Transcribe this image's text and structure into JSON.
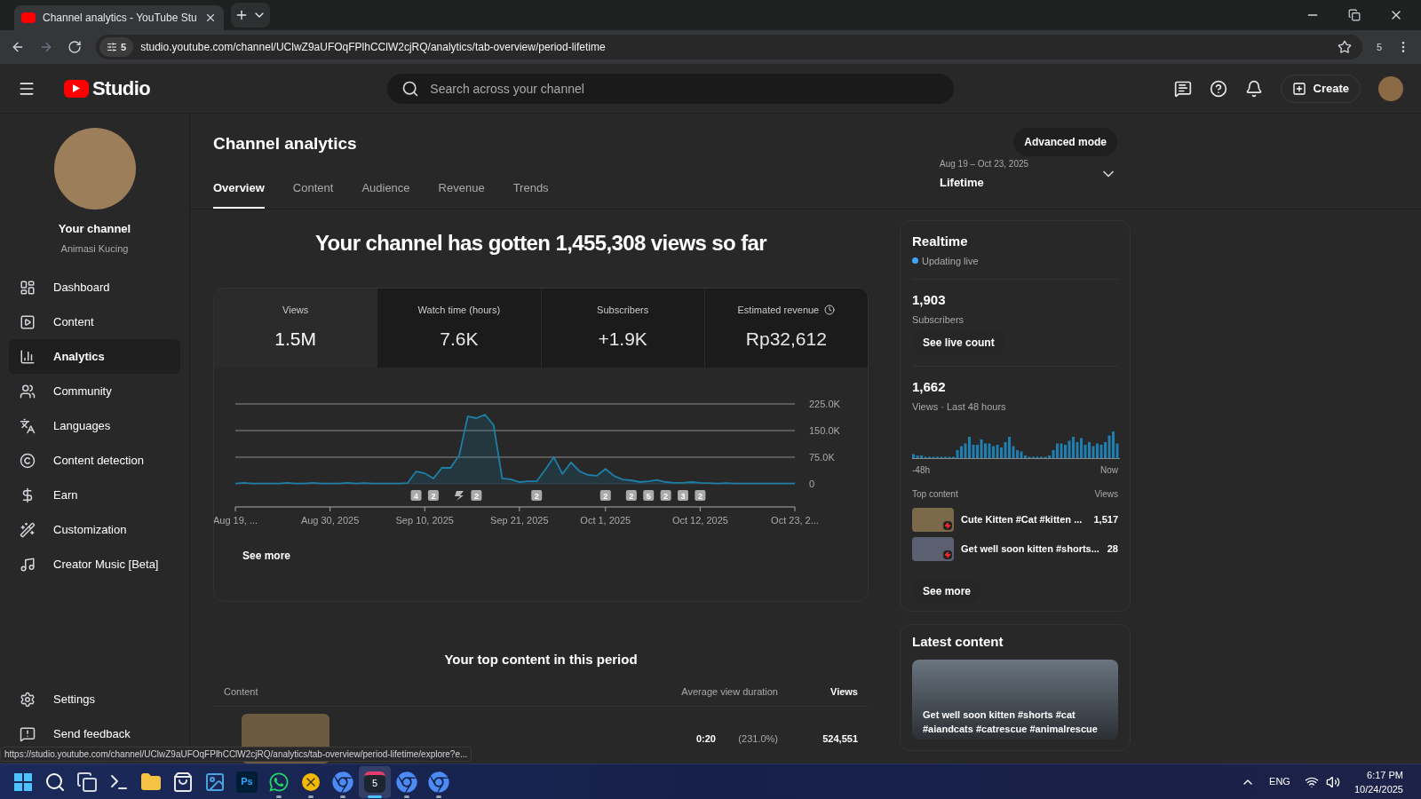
{
  "browser": {
    "tab_title": "Channel analytics - YouTube Stu",
    "url": "studio.youtube.com/channel/UClwZ9aUFOqFPlhCClW2cjRQ/analytics/tab-overview/period-lifetime",
    "site_badge": "5",
    "extensions_count": "5"
  },
  "header": {
    "logo": "Studio",
    "search": {
      "placeholder": "Search across your channel"
    },
    "create": "Create"
  },
  "sidebar": {
    "channel_title": "Your channel",
    "channel_name": "Animasi Kucing",
    "items": [
      {
        "label": "Dashboard",
        "selected": false
      },
      {
        "label": "Content",
        "selected": false
      },
      {
        "label": "Analytics",
        "selected": true
      },
      {
        "label": "Community",
        "selected": false
      },
      {
        "label": "Languages",
        "selected": false
      },
      {
        "label": "Content detection",
        "selected": false
      },
      {
        "label": "Earn",
        "selected": false
      },
      {
        "label": "Customization",
        "selected": false
      },
      {
        "label": "Creator Music [Beta]",
        "selected": false
      }
    ],
    "footer_items": [
      {
        "label": "Settings"
      },
      {
        "label": "Send feedback"
      }
    ]
  },
  "page": {
    "title": "Channel analytics",
    "advanced_mode": "Advanced mode",
    "tabs": [
      {
        "label": "Overview",
        "selected": true
      },
      {
        "label": "Content",
        "selected": false
      },
      {
        "label": "Audience",
        "selected": false
      },
      {
        "label": "Revenue",
        "selected": false
      },
      {
        "label": "Trends",
        "selected": false
      }
    ],
    "date_range": {
      "dates": "Aug 19 – Oct 23, 2025",
      "period": "Lifetime"
    }
  },
  "headline": "Your channel has gotten 1,455,308 views so far",
  "metrics": [
    {
      "label": "Views",
      "value": "1.5M",
      "selected": true
    },
    {
      "label": "Watch time (hours)",
      "value": "7.6K",
      "selected": false
    },
    {
      "label": "Subscribers",
      "value": "+1.9K",
      "selected": false
    },
    {
      "label": "Estimated revenue",
      "value": "Rp32,612",
      "selected": false
    }
  ],
  "chart_data": {
    "type": "area",
    "categories": [
      "Aug 19, ...",
      null,
      null,
      null,
      null,
      null,
      null,
      null,
      null,
      null,
      null,
      "Aug 30, 2025",
      null,
      null,
      null,
      null,
      null,
      null,
      null,
      null,
      null,
      null,
      "Sep 10, 2025",
      null,
      null,
      null,
      null,
      null,
      null,
      null,
      null,
      null,
      null,
      "Sep 21, 2025",
      null,
      null,
      null,
      null,
      null,
      null,
      null,
      null,
      null,
      "Oct 1, 2025",
      null,
      null,
      null,
      null,
      null,
      null,
      null,
      null,
      null,
      null,
      "Oct 12, 2025",
      null,
      null,
      null,
      null,
      null,
      null,
      null,
      null,
      null,
      null,
      "Oct 23, 2..."
    ],
    "series": [
      {
        "color": "#1d7fa8",
        "values": [
          1000,
          3000,
          1000,
          1000,
          1000,
          1000,
          3000,
          1000,
          1000,
          3000,
          1000,
          1000,
          1000,
          3000,
          1000,
          2000,
          1000,
          1000,
          1000,
          1000,
          2000,
          35000,
          30000,
          15000,
          45000,
          45000,
          80000,
          190000,
          185000,
          195000,
          165000,
          15000,
          13000,
          5000,
          7000,
          7000,
          40000,
          75000,
          28000,
          60000,
          35000,
          25000,
          23000,
          42000,
          22000,
          12000,
          10000,
          5000,
          7000,
          11000,
          5000,
          3000,
          3000,
          5000,
          3000,
          2000,
          1000,
          2000,
          1000,
          1000,
          1000,
          1000,
          1000,
          1000,
          1000,
          1000
        ]
      }
    ],
    "ylim": [
      0,
      225000
    ],
    "yticks": [
      {
        "value": 0,
        "label": "0"
      },
      {
        "value": 75000,
        "label": "75.0K"
      },
      {
        "value": 150000,
        "label": "150.0K"
      },
      {
        "value": 225000,
        "label": "225.0K"
      }
    ],
    "annotations": [
      "4",
      "2",
      "2",
      "2",
      "2",
      "2",
      "5",
      "2",
      "3",
      "2"
    ]
  },
  "see_more": "See more",
  "top_content": {
    "title": "Your top content in this period",
    "columns": [
      "Content",
      "Average view duration",
      "Views"
    ],
    "rows": [
      {
        "duration": "0:20",
        "percent": "(231.0%)",
        "views": "524,551"
      }
    ]
  },
  "realtime": {
    "title": "Realtime",
    "status": "Updating live",
    "subscribers": "1,903",
    "subscribers_label": "Subscribers",
    "live_count_button": "See live count",
    "views": "1,662",
    "views_label": "Views · Last 48 hours",
    "axis_start": "-48h",
    "axis_end": "Now",
    "top_content_label": "Top content",
    "views_column": "Views",
    "items": [
      {
        "title": "Cute Kitten #Cat #kitten ...",
        "views": "1,517"
      },
      {
        "title": "Get well soon kitten #shorts...",
        "views": "28"
      }
    ],
    "see_more": "See more"
  },
  "latest_content": {
    "title": "Latest content",
    "video_title": "Get well soon kitten #shorts #cat #aiandcats #catrescue #animalrescue"
  },
  "status_url": "https://studio.youtube.com/channel/UClwZ9aUFOqFPlhCClW2cjRQ/analytics/tab-overview/period-lifetime/explore?e...",
  "taskbar": {
    "apps": [
      {
        "running": false,
        "active": false
      },
      {
        "running": false,
        "active": false
      },
      {
        "running": false,
        "active": false
      },
      {
        "running": false,
        "active": false
      },
      {
        "running": false,
        "active": false
      },
      {
        "running": false,
        "active": false
      },
      {
        "running": false,
        "active": false
      },
      {
        "running": false,
        "active": false,
        "label": "Ps"
      },
      {
        "running": true,
        "active": false
      },
      {
        "running": true,
        "active": false
      },
      {
        "running": true,
        "active": false
      },
      {
        "running": true,
        "active": true,
        "label": "5"
      },
      {
        "running": true,
        "active": false
      },
      {
        "running": true,
        "active": false
      }
    ],
    "language": "ENG",
    "time": "6:17 PM",
    "date": "10/24/2025"
  }
}
